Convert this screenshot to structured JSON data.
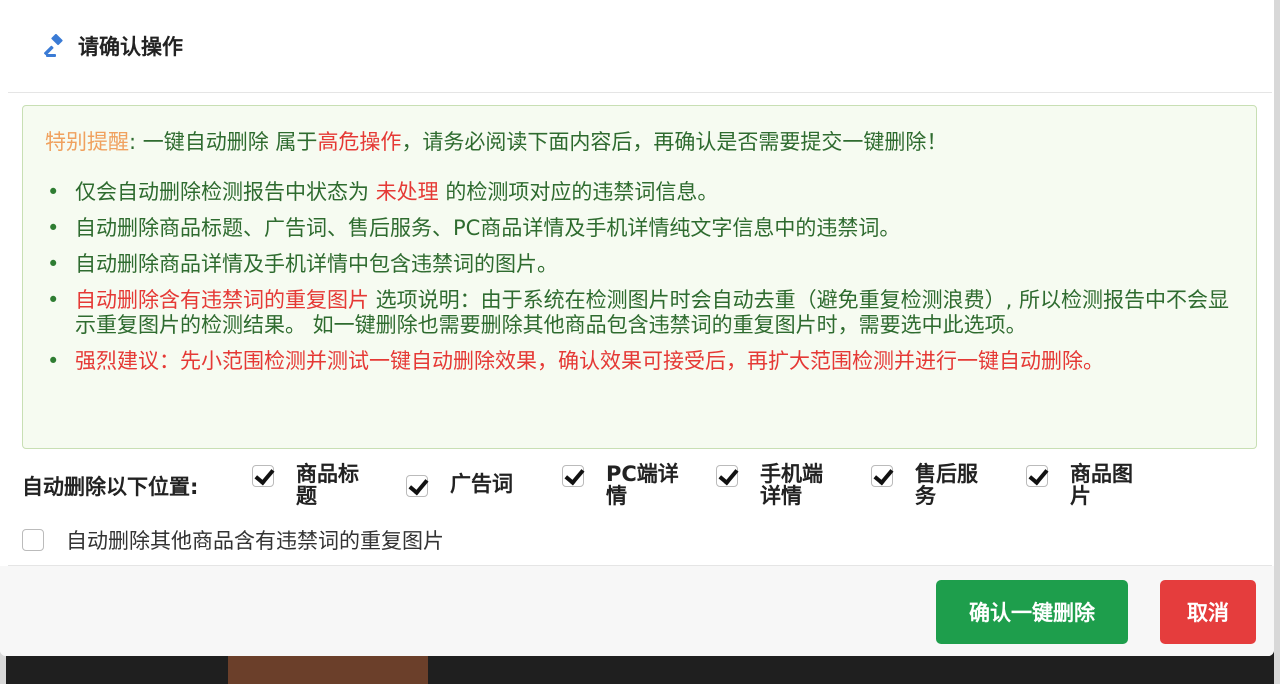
{
  "modal": {
    "title": "请确认操作",
    "title_icon": "gavel-icon"
  },
  "alert": {
    "prefix": "特别提醒",
    "line1_a": ": 一键自动删除 属于",
    "line1_danger": "高危操作",
    "line1_b": "，请务必阅读下面内容后，再确认是否需要提交一键删除！",
    "items": [
      {
        "a": "仅会自动删除检测报告中状态为 ",
        "red": "未处理",
        "b": " 的检测项对应的违禁词信息。"
      },
      {
        "text": "自动删除商品标题、广告词、售后服务、PC商品详情及手机详情纯文字信息中的违禁词。"
      },
      {
        "text": "自动删除商品详情及手机详情中包含违禁词的图片。"
      },
      {
        "red": "自动删除含有违禁词的重复图片",
        "b": " 选项说明：由于系统在检测图片时会自动去重（避免重复检测浪费）, 所以检测报告中不会显示重复图片的检测结果。 如一键删除也需要删除其他商品包含违禁词的重复图片时，需要选中此选项。"
      },
      {
        "red": "强烈建议：先小范围检测并测试一键自动删除效果，确认效果可接受后，再扩大范围检测并进行一键自动删除。"
      }
    ]
  },
  "positions": {
    "label": "自动删除以下位置:",
    "options": [
      {
        "label": "商品标题",
        "checked": true
      },
      {
        "label": "广告词",
        "checked": true
      },
      {
        "label": "PC端详情",
        "checked": true
      },
      {
        "label": "手机端详情",
        "checked": true
      },
      {
        "label": "售后服务",
        "checked": true
      },
      {
        "label": "商品图片",
        "checked": true
      }
    ]
  },
  "other_duplicate": {
    "label": "自动删除其他商品含有违禁词的重复图片",
    "checked": false
  },
  "footer": {
    "confirm_label": "确认一键删除",
    "cancel_label": "取消"
  },
  "colors": {
    "confirm": "#1e9e4c",
    "cancel": "#e53d3d",
    "alert_text": "#2e7d32",
    "danger": "#e53935",
    "warning_prefix": "#f0a15e"
  }
}
